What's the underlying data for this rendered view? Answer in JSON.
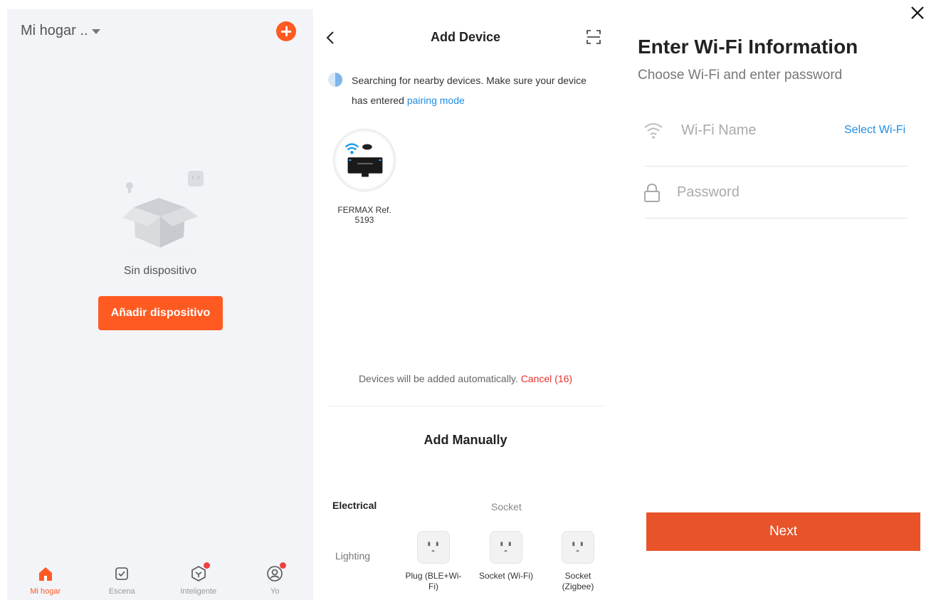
{
  "home": {
    "title": "Mi hogar ..",
    "empty_text": "Sin dispositivo",
    "add_button": "Añadir dispositivo",
    "tabs": [
      {
        "label": "Mi hogar",
        "icon": "home-icon",
        "active": true
      },
      {
        "label": "Escena",
        "icon": "scene-checkbox-icon",
        "active": false
      },
      {
        "label": "Inteligente",
        "icon": "smart-cube-icon",
        "active": false
      },
      {
        "label": "Yo",
        "icon": "profile-icon",
        "active": false
      }
    ],
    "accent_color": "#ff5a22"
  },
  "add_device": {
    "title": "Add Device",
    "search_text": "Searching for nearby devices. Make sure your device has entered",
    "pairing_link": "pairing mode",
    "found_device": {
      "name": "FERMAX Ref. 5193",
      "icon": "wifi-relay-device-icon"
    },
    "auto_text": "Devices will be added automatically.",
    "cancel_label": "Cancel (16)",
    "manual_title": "Add Manually",
    "categories": [
      {
        "label": "Electrical",
        "selected": true
      },
      {
        "label": "Lighting",
        "selected": false
      }
    ],
    "section_title": "Socket",
    "devices": [
      {
        "label": "Plug (BLE+Wi-Fi)",
        "icon": "plug-icon"
      },
      {
        "label": "Socket (Wi-Fi)",
        "icon": "socket-icon"
      },
      {
        "label": "Socket (Zigbee)",
        "icon": "socket-icon"
      }
    ]
  },
  "wifi": {
    "title": "Enter Wi-Fi Information",
    "subtitle": "Choose Wi-Fi and enter password",
    "wifi_name_placeholder": "Wi-Fi Name",
    "select_wifi": "Select Wi-Fi",
    "password_placeholder": "Password",
    "next_label": "Next",
    "link_color": "#1f8ee6",
    "button_color": "#e8532a"
  }
}
